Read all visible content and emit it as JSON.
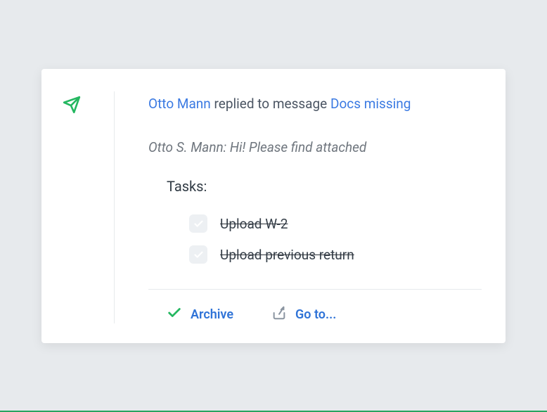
{
  "notification": {
    "sender": "Otto Mann",
    "action_verb": "replied to message",
    "message_title": "Docs missing",
    "preview": "Otto S. Mann: Hi! Please find attached",
    "tasks_heading": "Tasks:",
    "tasks": [
      {
        "label": "Upload W-2",
        "completed": true
      },
      {
        "label": "Upload previous return",
        "completed": true
      }
    ]
  },
  "actions": {
    "archive": "Archive",
    "goto": "Go to..."
  },
  "icons": {
    "plane": "paper-plane-icon",
    "check": "check-icon",
    "share": "share-icon"
  },
  "colors": {
    "accent_green": "#2aa35f",
    "accent_blue": "#3b7ae2",
    "text_gray": "#4b5563"
  }
}
